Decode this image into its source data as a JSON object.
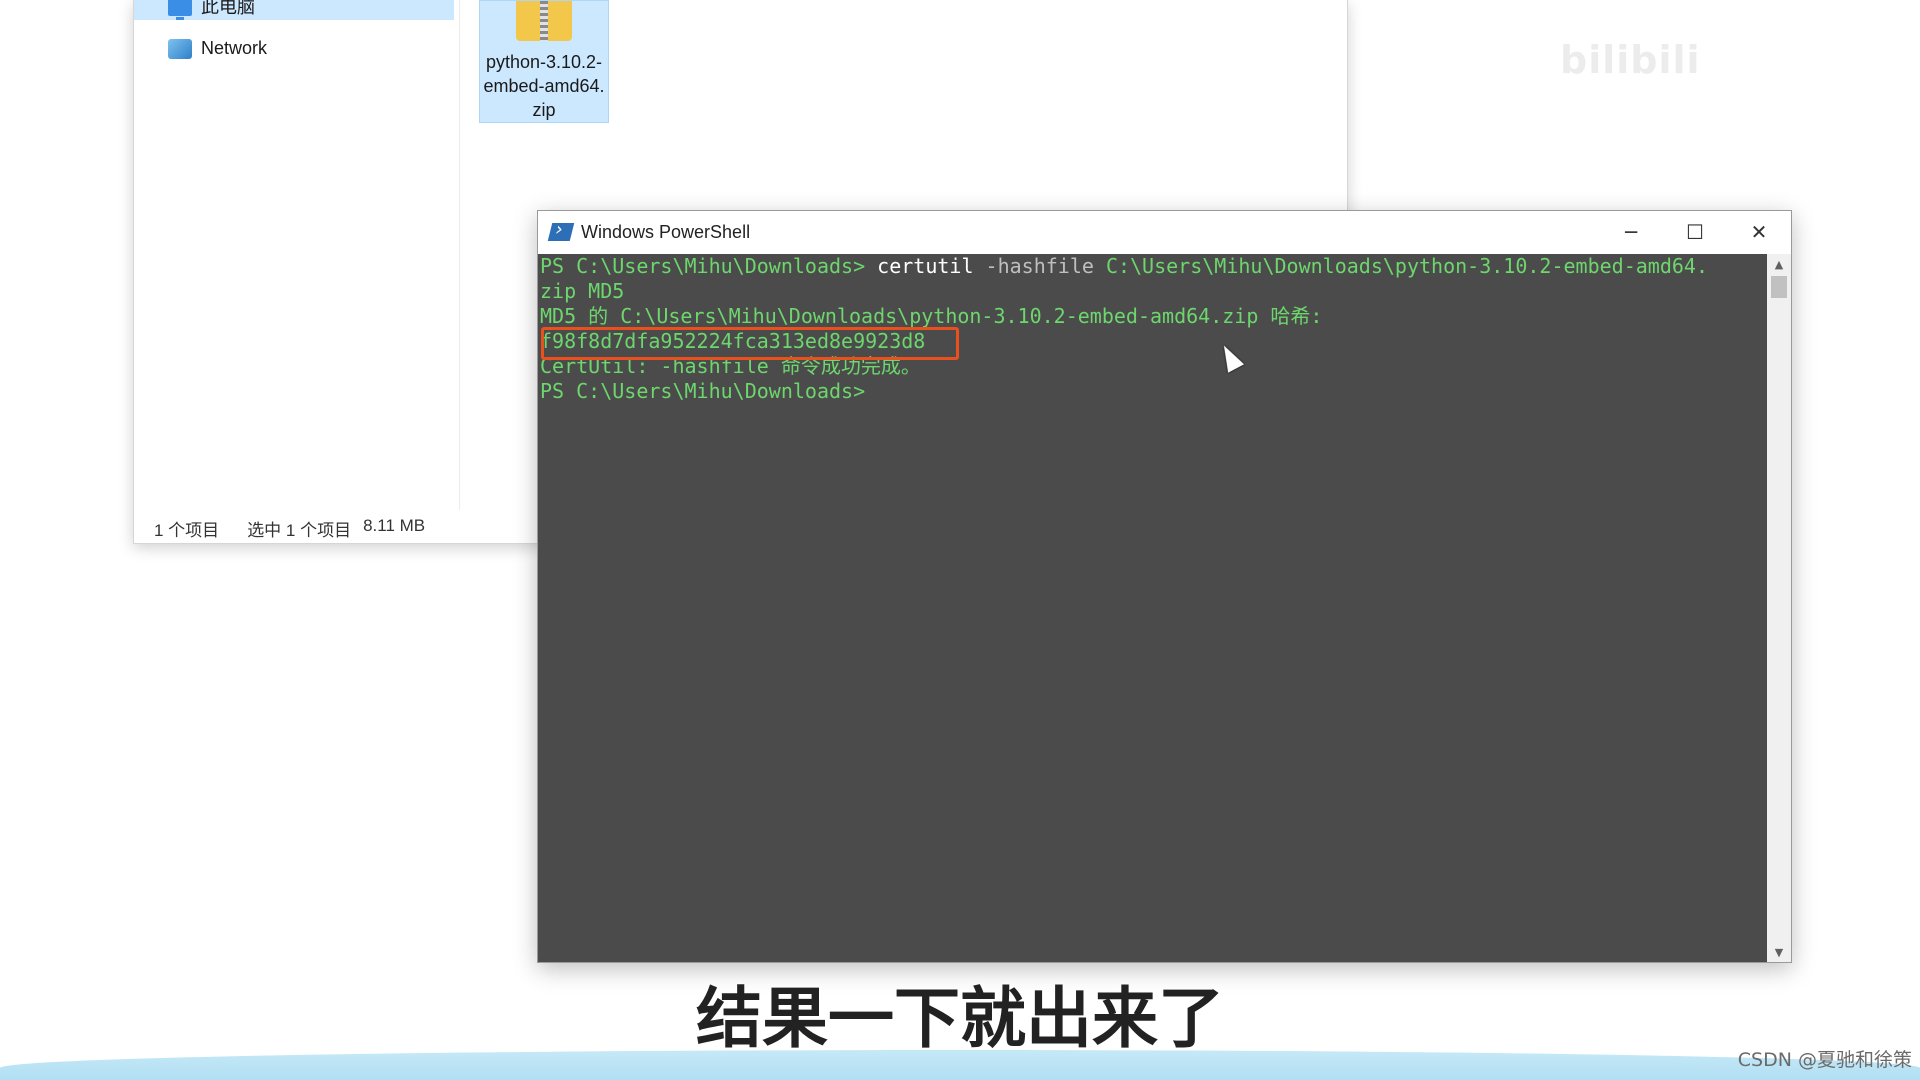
{
  "explorer": {
    "nav_items": [
      {
        "label": "此电脑",
        "icon": "computer-icon"
      },
      {
        "label": "Network",
        "icon": "network-icon"
      }
    ],
    "file": {
      "name": "python-3.10.2-embed-amd64.zip",
      "icon": "zip-folder-icon"
    },
    "status": {
      "items_count": "1 个项目",
      "selected": "选中 1 个项目",
      "size": "8.11 MB"
    }
  },
  "powershell": {
    "title": "Windows PowerShell",
    "icon": "powershell-icon",
    "lines": {
      "l1_prompt": "PS C:\\Users\\Mihu\\Downloads> ",
      "l1_cmd": "certutil",
      "l1_param": " -hashfile ",
      "l1_path": "C:\\Users\\Mihu\\Downloads\\python-3.10.2-embed-amd64.",
      "l2": "zip MD5",
      "l3": "MD5 的 C:\\Users\\Mihu\\Downloads\\python-3.10.2-embed-amd64.zip 哈希:",
      "l4_hash": "f98f8d7dfa952224fca313ed8e9923d8",
      "l5": "CertUtil: -hashfile 命令成功完成。",
      "l6": "PS C:\\Users\\Mihu\\Downloads>"
    },
    "highlight_color": "#e8501e",
    "console_bg": "#4b4b4b",
    "console_fg": "#6dd66d"
  },
  "subtitle": "结果一下就出来了",
  "watermarks": {
    "top": "bilibili",
    "bottom": "CSDN @夏驰和徐策"
  }
}
